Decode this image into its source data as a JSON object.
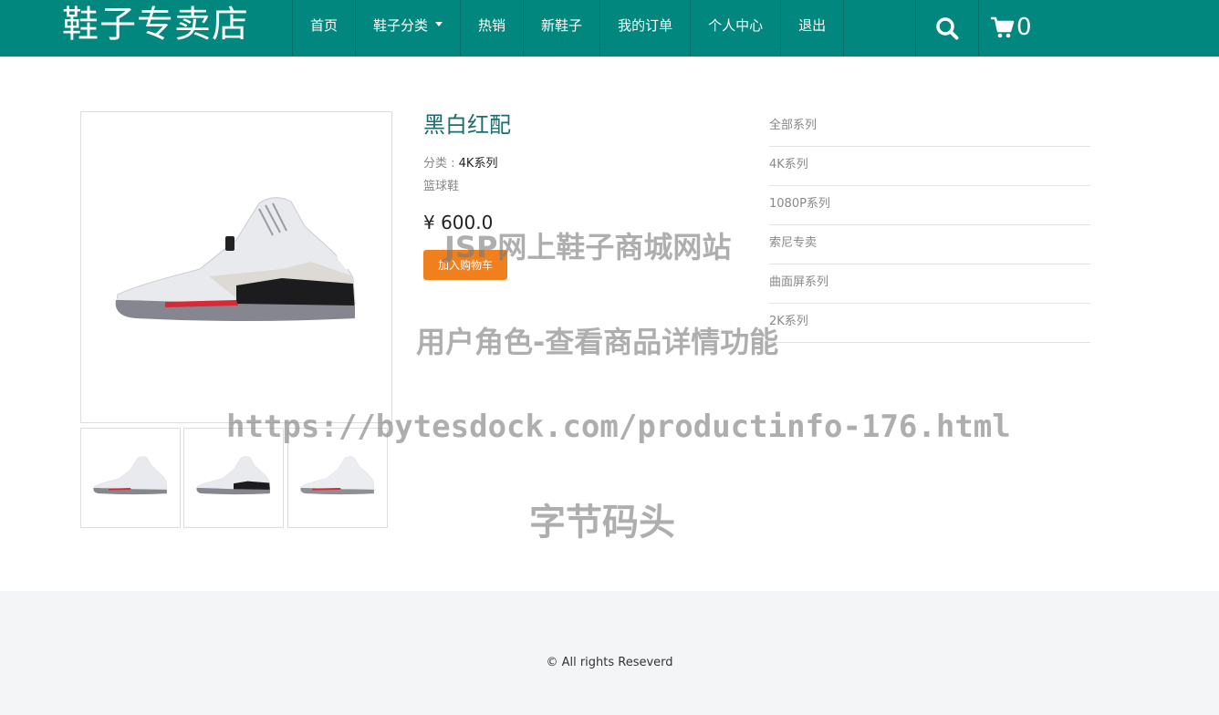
{
  "header": {
    "brand": "鞋子专卖店",
    "nav": [
      {
        "label": "首页"
      },
      {
        "label": "鞋子分类",
        "has_dropdown": true
      },
      {
        "label": "热销"
      },
      {
        "label": "新鞋子"
      },
      {
        "label": "我的订单"
      },
      {
        "label": "个人中心"
      },
      {
        "label": "退出"
      }
    ],
    "cart_count": "0",
    "icons": {
      "search": "search-icon",
      "cart": "shopping-cart-icon"
    },
    "colors": {
      "bar": "#02877f"
    }
  },
  "product": {
    "title": "黑白红配",
    "category_label": "分类 : ",
    "category_value": "4K系列",
    "description": "篮球鞋",
    "price": "¥ 600.0",
    "add_to_cart_label": "加入购物车",
    "thumbnail_count": 3
  },
  "sidebar": {
    "categories": [
      "全部系列",
      "4K系列",
      "1080P系列",
      "索尼专卖",
      "曲面屏系列",
      "2K系列"
    ]
  },
  "watermark": {
    "line1": "JSP网上鞋子商城网站",
    "line2": "用户角色-查看商品详情功能",
    "line3": "https://bytesdock.com/productinfo-176.html",
    "line4": "字节码头"
  },
  "footer": {
    "copyright": "© All rights Reseverd"
  }
}
